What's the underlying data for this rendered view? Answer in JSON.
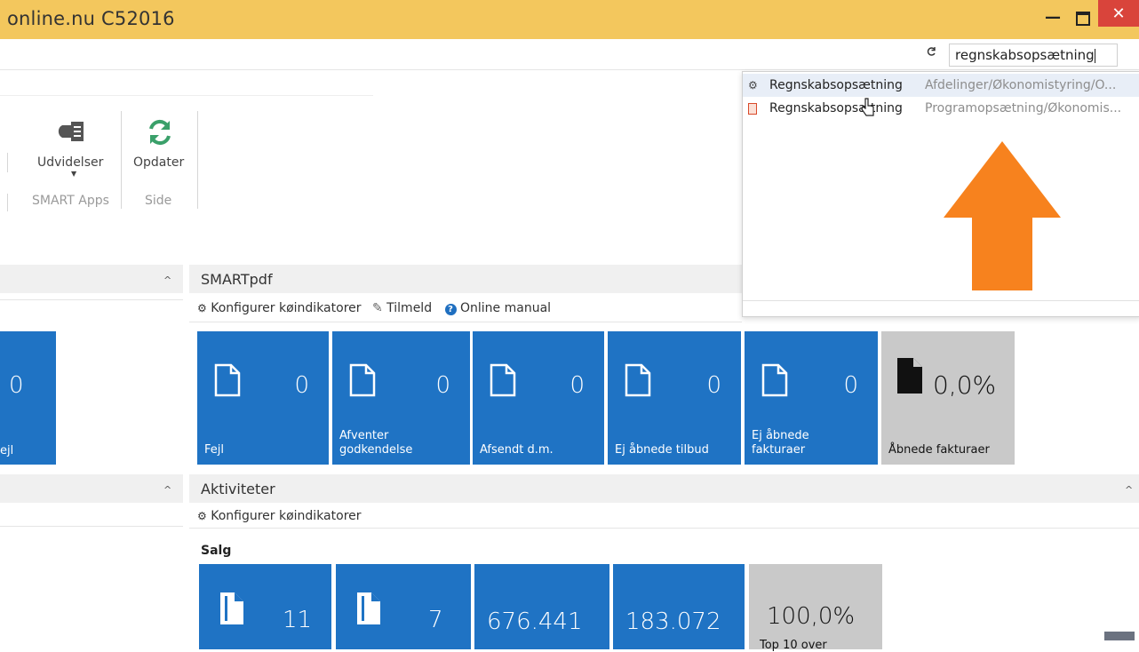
{
  "window": {
    "title": "online.nu C52016",
    "close_glyph": "✕",
    "minimize_glyph": "—"
  },
  "search": {
    "value": "regnskabsopsætning"
  },
  "ribbon": {
    "udvidelser_label": "Udvidelser",
    "opdater_label": "Opdater",
    "smart_apps_group": "SMART Apps",
    "side_group": "Side"
  },
  "dropdown": {
    "items": [
      {
        "label": "Regnskabsopsætning",
        "path": "Afdelinger/Økonomistyring/O..."
      },
      {
        "label": "Regnskabsopsætning",
        "path": "Programopsætning/Økonomis..."
      }
    ]
  },
  "smartpdf": {
    "title": "SMARTpdf",
    "configure": "Konfigurer køindikatorer",
    "subscribe": "Tilmeld",
    "manual": "Online manual",
    "tiles": [
      {
        "value": "0",
        "label": "Fejl"
      },
      {
        "value": "0",
        "label": "Afventer godkendelse"
      },
      {
        "value": "0",
        "label": "Afsendt d.m."
      },
      {
        "value": "0",
        "label": "Ej åbnede tilbud"
      },
      {
        "value": "0",
        "label": "Ej åbnede fakturaer"
      },
      {
        "value": "0,0%",
        "label": "Åbnede fakturaer"
      }
    ]
  },
  "left_tile": {
    "value": "0",
    "label": "ejl"
  },
  "activities": {
    "title": "Aktiviteter",
    "configure": "Konfigurer køindikatorer",
    "salg_label": "Salg",
    "tiles": [
      {
        "value": "11"
      },
      {
        "value": "7"
      },
      {
        "value": "676.441"
      },
      {
        "value": "183.072"
      },
      {
        "value": "100,0%",
        "label": "Top 10 over"
      }
    ]
  },
  "colors": {
    "titlebar": "#f3c75d",
    "tile_blue": "#1f73c4",
    "tile_grey": "#c9c9c9",
    "arrow_orange": "#f7821e",
    "close_red": "#d9443b"
  }
}
